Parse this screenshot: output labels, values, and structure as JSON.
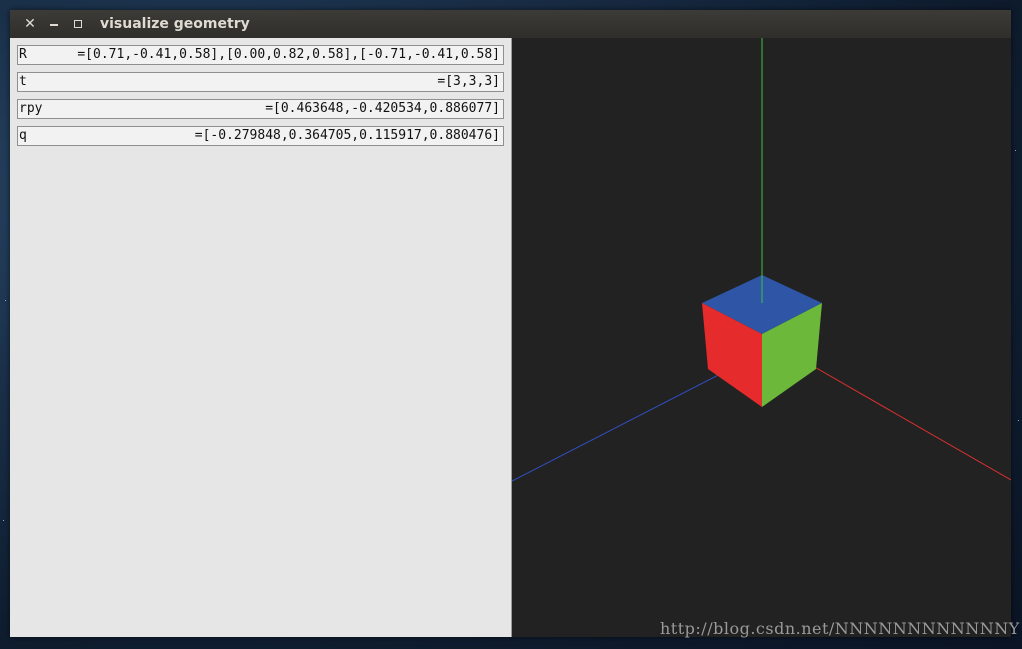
{
  "window": {
    "title": "visualize geometry",
    "controls": [
      "close-icon",
      "minimize-icon",
      "maximize-icon"
    ]
  },
  "fields": [
    {
      "label": "R",
      "value": "=[0.71,-0.41,0.58],[0.00,0.82,0.58],[-0.71,-0.41,0.58]"
    },
    {
      "label": "t",
      "value": "=[3,3,3]"
    },
    {
      "label": "rpy",
      "value": "=[0.463648,-0.420534,0.886077]"
    },
    {
      "label": "q",
      "value": "=[-0.279848,0.364705,0.115917,0.880476]"
    }
  ],
  "viewport": {
    "background": "#222222",
    "axis_colors": {
      "x": "#d93030",
      "y": "#40c040",
      "z": "#3050c0"
    },
    "cube_face_colors": {
      "top": "#2e55a6",
      "left": "#e52b2b",
      "right": "#6cb83a"
    }
  },
  "watermark": "http://blog.csdn.net/NNNNNNNNNNNNY"
}
